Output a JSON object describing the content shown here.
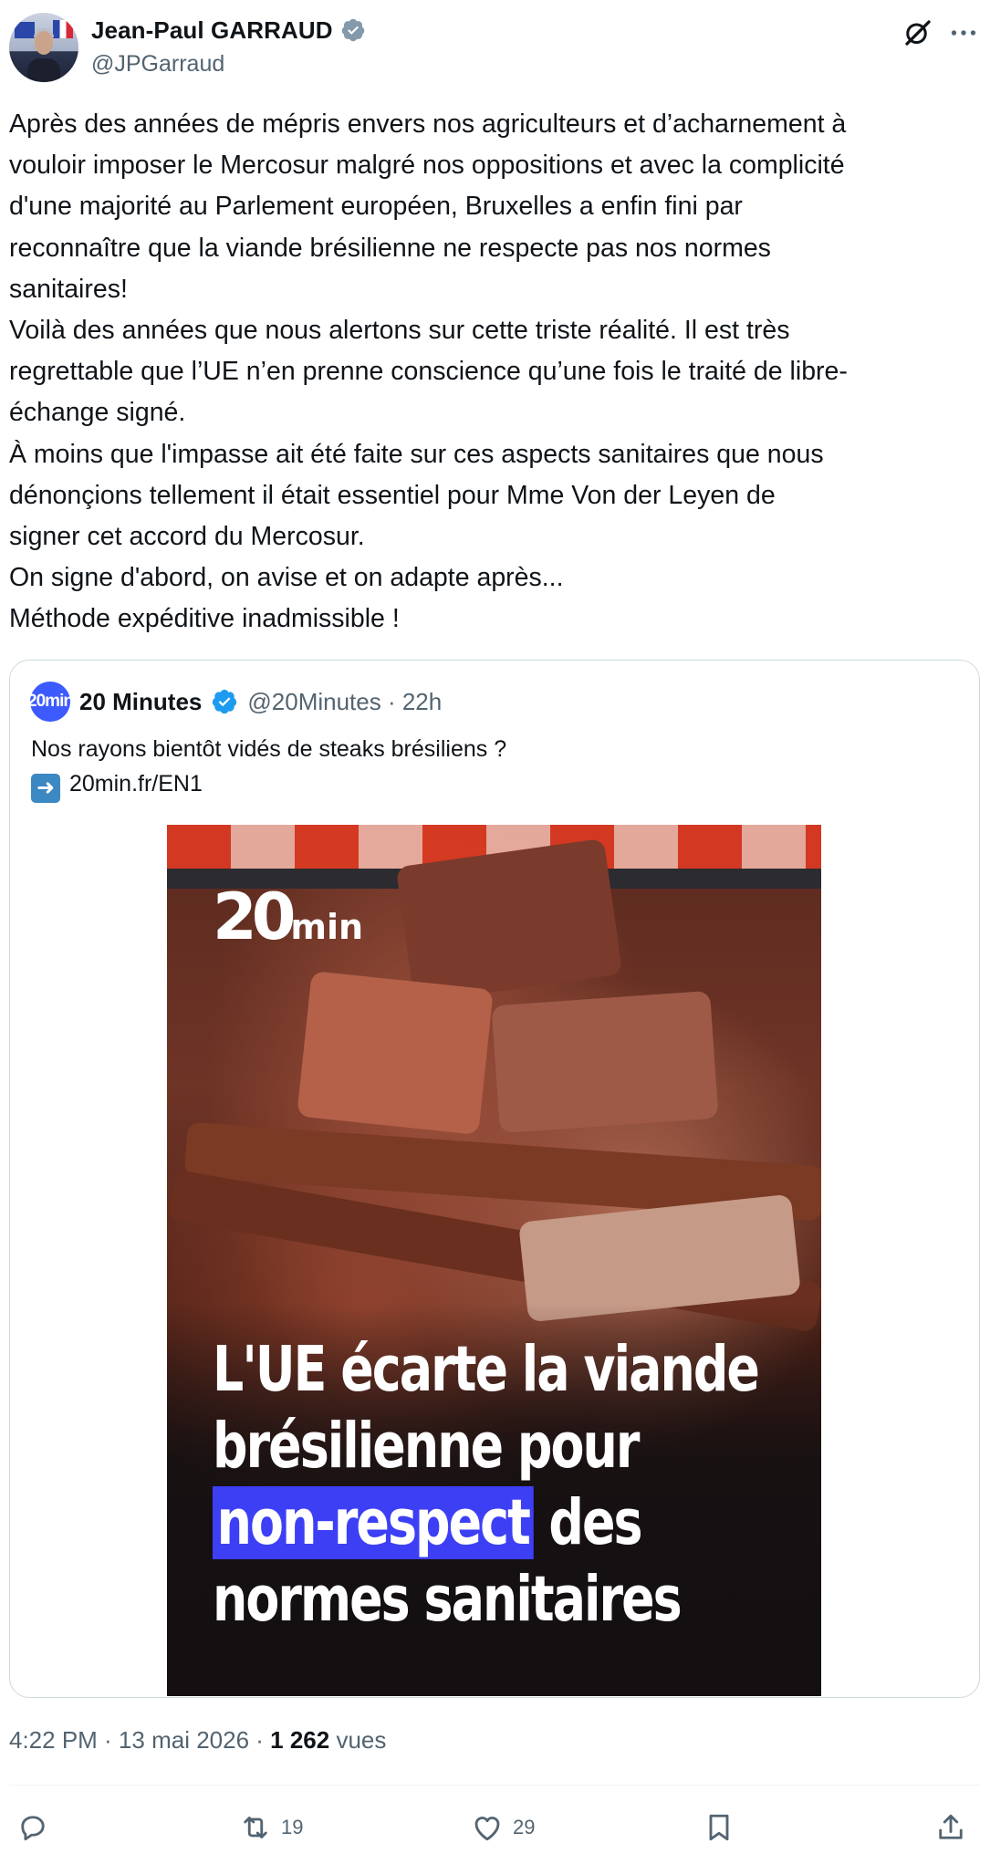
{
  "author": {
    "display_name": "Jean-Paul GARRAUD",
    "handle": "@JPGarraud",
    "verified": true
  },
  "tweet": {
    "lines": [
      "Après des années de mépris envers nos agriculteurs et d’acharnement à",
      "vouloir imposer le Mercosur malgré nos oppositions et avec la complicité",
      "d'une majorité au Parlement européen, Bruxelles a enfin fini par",
      "reconnaître que la viande brésilienne ne respecte pas nos normes",
      "sanitaires!",
      "Voilà des années que nous alertons sur cette triste réalité. Il est très",
      "regrettable que l’UE n’en prenne conscience qu’une fois le traité de libre-",
      "échange signé.",
      "À moins que l'impasse ait été faite sur ces aspects sanitaires que nous",
      "dénonçions tellement il était essentiel pour Mme Von der Leyen de",
      "signer cet accord du Mercosur.",
      "On signe d'abord, on avise et on adapte après...",
      "Méthode expéditive inadmissible !"
    ]
  },
  "quote": {
    "avatar_text": "20min",
    "display_name": "20 Minutes",
    "handle_time": "@20Minutes · 22h",
    "text_line1": "Nos rayons bientôt vidés de steaks brésiliens ?",
    "link": "20min.fr/EN1",
    "image": {
      "logo_number": "20",
      "logo_suffix": "min",
      "headline_line1": "L'UE écarte la viande",
      "headline_line2": "brésilienne pour",
      "headline_highlight": "non-respect",
      "headline_line3_rest": "des",
      "headline_line4": "normes sanitaires",
      "highlight_color": "#3d3ff5"
    }
  },
  "meta": {
    "time_date": "4:22 PM · 13 mai 2026 · ",
    "views_count": "1 262",
    "views_label": " vues"
  },
  "actions": {
    "replies": "",
    "retweets": "19",
    "likes": "29"
  },
  "colors": {
    "text": "#0f1419",
    "secondary": "#536471",
    "verified": "#829aab",
    "quote_verified": "#1d9bf0"
  }
}
